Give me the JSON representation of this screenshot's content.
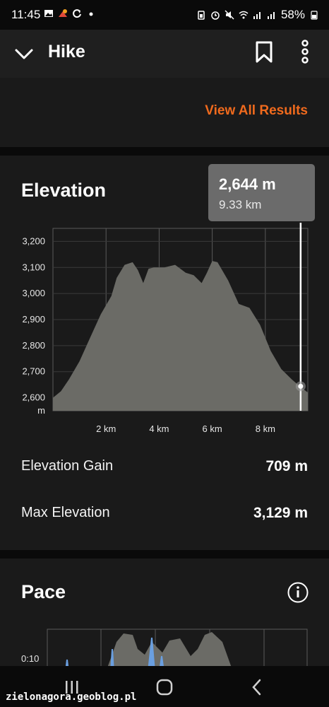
{
  "status_bar": {
    "time": "11:45",
    "battery": "58%",
    "left_icons": [
      "image-icon",
      "app-icon",
      "sync-icon",
      "dot-icon"
    ],
    "right_icons": [
      "battery-saver-icon",
      "alarm-icon",
      "mute-icon",
      "wifi-icon",
      "signal-icon",
      "signal-icon",
      "battery-icon"
    ]
  },
  "app_bar": {
    "title": "Hike",
    "icons": [
      "chevron-down-icon",
      "bookmark-icon",
      "more-vertical-icon"
    ]
  },
  "results": {
    "view_all_label": "View All Results",
    "accent_color": "#f06a1d"
  },
  "elevation": {
    "title": "Elevation",
    "tooltip": {
      "value": "2,644 m",
      "distance": "9.33 km"
    },
    "stats": [
      {
        "label": "Elevation Gain",
        "value": "709 m"
      },
      {
        "label": "Max Elevation",
        "value": "3,129 m"
      }
    ]
  },
  "chart_data": {
    "type": "area",
    "title": "",
    "xlabel": "",
    "ylabel": "m",
    "ylim": [
      2550,
      3250
    ],
    "xlim": [
      0,
      9.6
    ],
    "grid": true,
    "x_ticks": [
      "2 km",
      "4 km",
      "6 km",
      "8 km"
    ],
    "x_tick_values": [
      2,
      4,
      6,
      8
    ],
    "y_ticks": [
      "3,200",
      "3,100",
      "3,000",
      "2,900",
      "2,800",
      "2,700",
      "2,600"
    ],
    "y_tick_values": [
      3200,
      3100,
      3000,
      2900,
      2800,
      2700,
      2600
    ],
    "y_unit_label": "m",
    "fill_color": "#6b6b66",
    "cursor": {
      "x": 9.33,
      "y": 2644
    },
    "series": [
      {
        "x": [
          0,
          0.3,
          0.6,
          1.0,
          1.4,
          1.8,
          2.2,
          2.4,
          2.7,
          3.0,
          3.2,
          3.4,
          3.6,
          3.8,
          4.2,
          4.6,
          5.0,
          5.3,
          5.6,
          5.8,
          6.0,
          6.2,
          6.6,
          7.0,
          7.4,
          7.8,
          8.2,
          8.6,
          9.0,
          9.3,
          9.6
        ],
        "values": [
          2600,
          2625,
          2670,
          2740,
          2830,
          2920,
          2990,
          3060,
          3110,
          3120,
          3090,
          3040,
          3095,
          3100,
          3100,
          3110,
          3080,
          3070,
          3040,
          3080,
          3125,
          3120,
          3050,
          2960,
          2945,
          2880,
          2780,
          2710,
          2670,
          2644,
          2620
        ]
      }
    ]
  },
  "pace": {
    "title": "Pace",
    "icons": [
      "info-icon"
    ],
    "y_tick_label": "0:10"
  },
  "nav_bar": {
    "icons": [
      "recent-apps-icon",
      "home-icon",
      "back-icon"
    ]
  },
  "watermark": "zielonagora.geoblog.pl"
}
